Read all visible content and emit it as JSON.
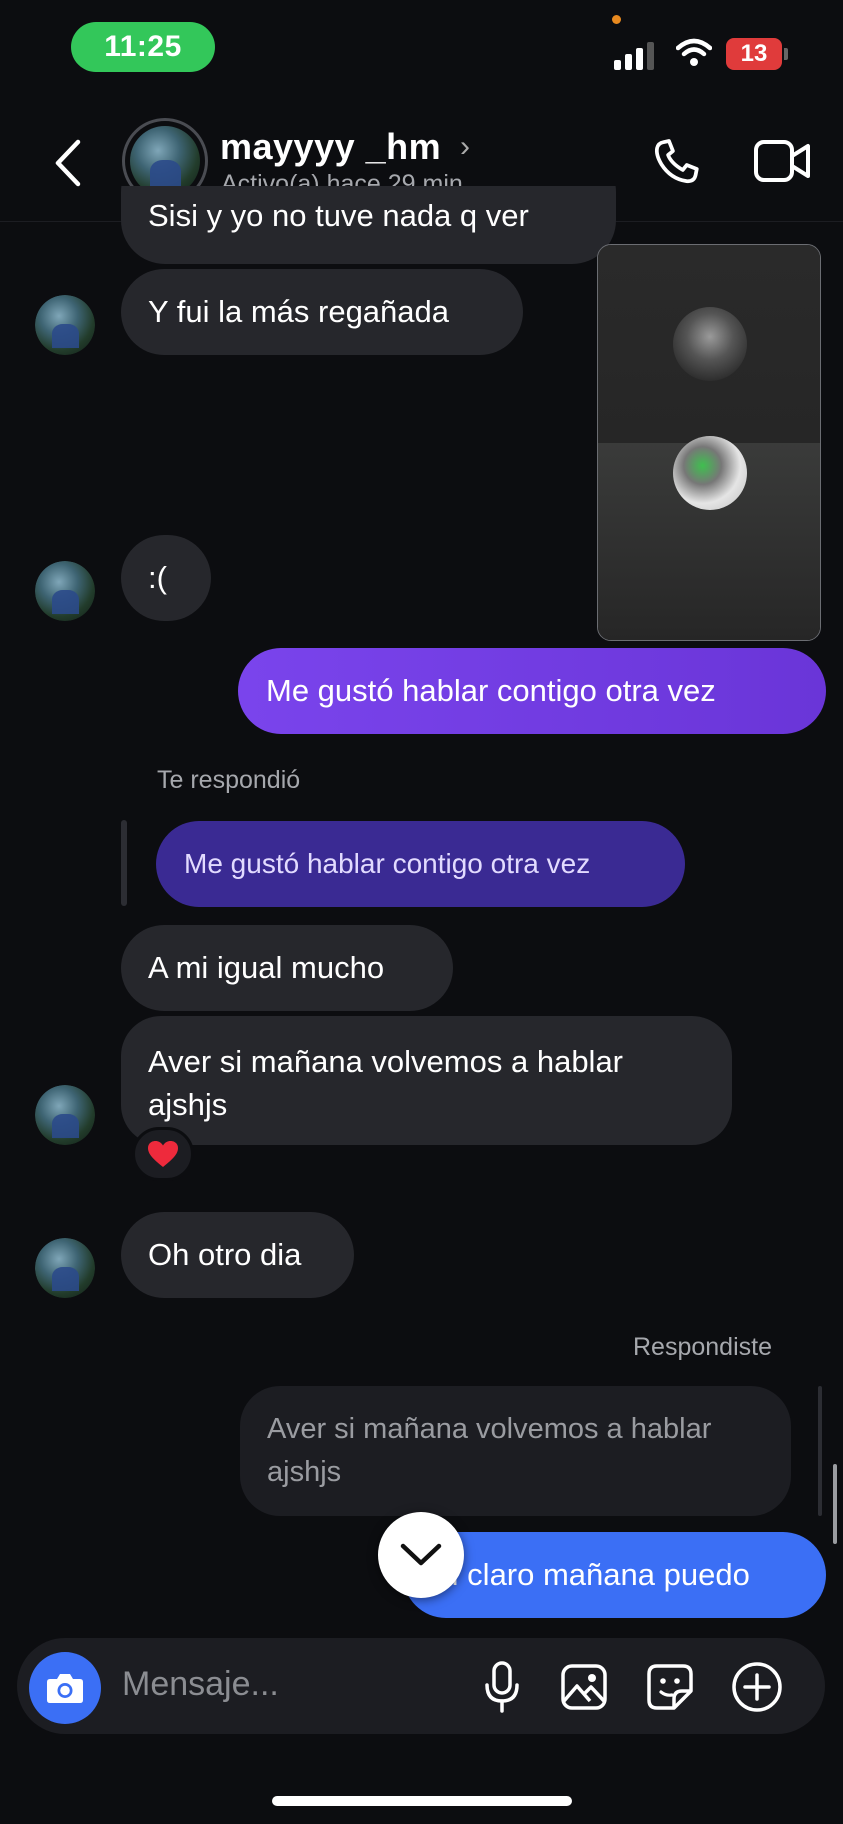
{
  "status_bar": {
    "time": "11:25",
    "battery": "13"
  },
  "header": {
    "username": "mayyyy _hm",
    "status": "Activo(a) hace 29 min"
  },
  "messages": {
    "partial_top": "Sisi y yo no tuve nada q ver",
    "m1": "Y fui la más regañada",
    "m2": ":(",
    "m3": "Me gustó hablar contigo otra vez",
    "reply_label_in": "Te respondió",
    "quoted_in": "Me gustó hablar contigo otra vez",
    "m4": "A mi igual mucho",
    "m5": "Aver si mañana volvemos a hablar ajshjs",
    "reaction": "❤️",
    "m6": "Oh otro dia",
    "reply_label_out": "Respondiste",
    "quoted_out": "Aver si mañana volvemos a hablar ajshjs",
    "m7": "Si claro mañana puedo"
  },
  "composer": {
    "placeholder": "Mensaje..."
  },
  "colors": {
    "accent_purple": "#6f3fe0",
    "accent_blue": "#3b6ff5",
    "incoming_bubble": "#26272c",
    "active_green": "#33c75a"
  }
}
